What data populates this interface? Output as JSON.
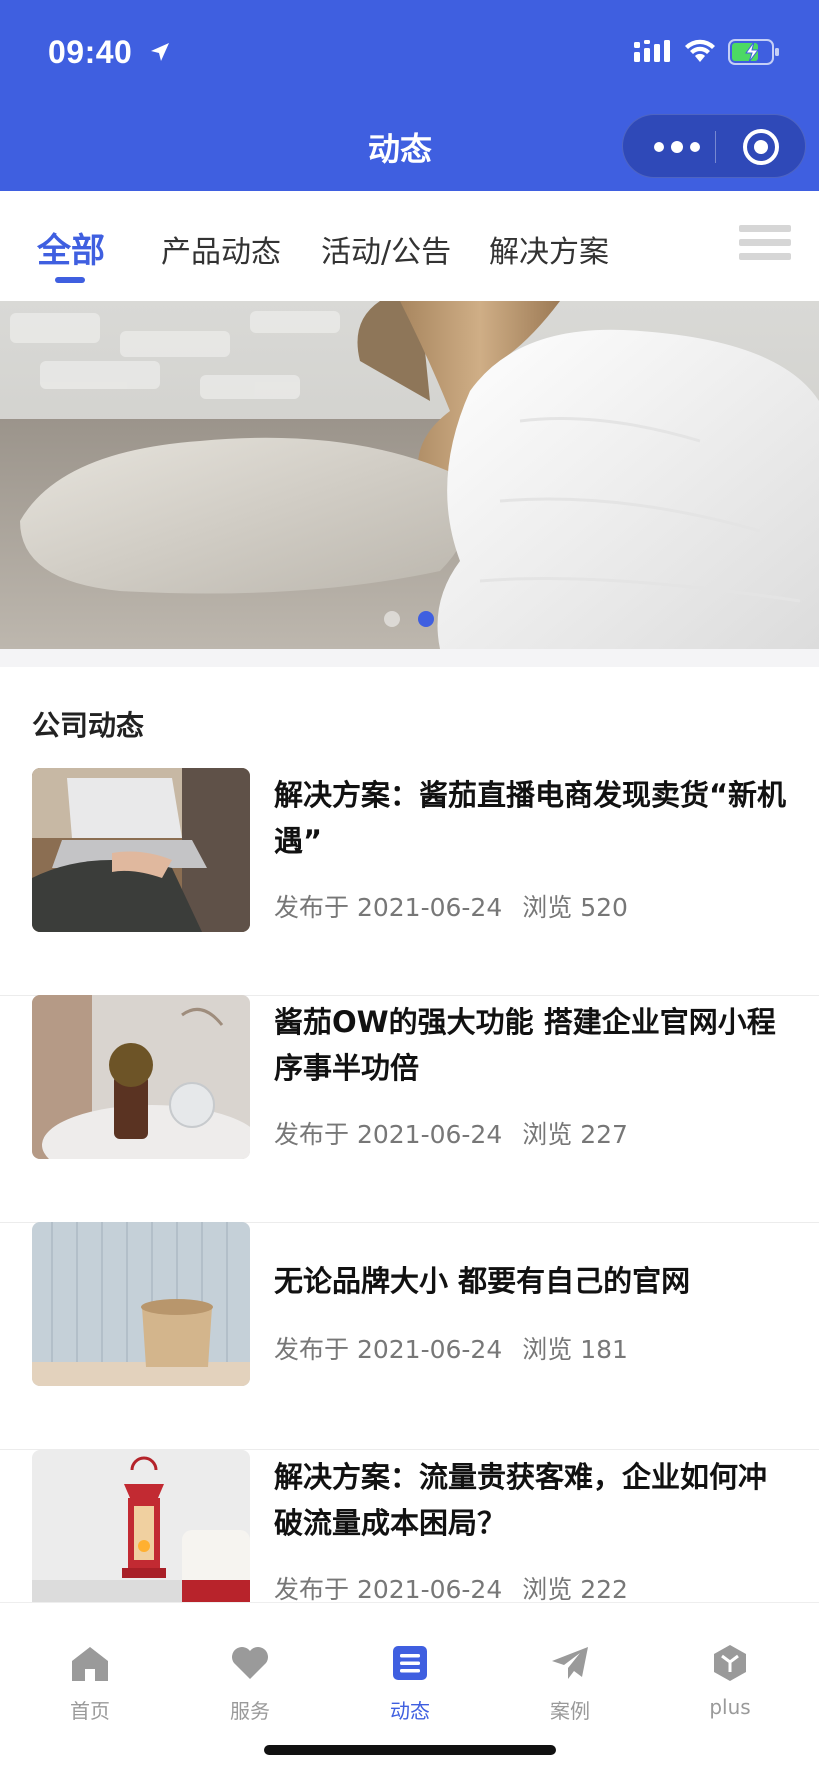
{
  "status_bar": {
    "time": "09:40"
  },
  "nav": {
    "title": "动态"
  },
  "colors": {
    "primary": "#3f5fe0",
    "text": "#222222",
    "meta": "#777777",
    "inactive": "#9a9a9a"
  },
  "tabs": [
    {
      "label": "全部",
      "active": true
    },
    {
      "label": "产品动态",
      "active": false
    },
    {
      "label": "活动/公告",
      "active": false
    },
    {
      "label": "解决方案",
      "active": false
    }
  ],
  "banner": {
    "slide_count": 2,
    "active_index": 1
  },
  "section": {
    "title": "公司动态"
  },
  "articles": [
    {
      "title": "解决方案：酱茄直播电商发现卖货“新机遇”",
      "published": "发布于 2021-06-24",
      "views": "浏览 520",
      "thumb_icon": "laptop-typing-photo"
    },
    {
      "title": "酱茄OW的强大功能 搭建企业官网小程序事半功倍",
      "published": "发布于 2021-06-24",
      "views": "浏览 227",
      "thumb_icon": "glass-bottle-photo"
    },
    {
      "title": "无论品牌大小 都要有自己的官网",
      "published": "发布于 2021-06-24",
      "views": "浏览 181",
      "thumb_icon": "wicker-basket-photo"
    },
    {
      "title": "解决方案：流量贵获客难，企业如何冲破流量成本困局？",
      "published": "发布于 2021-06-24",
      "views": "浏览 222",
      "thumb_icon": "red-lantern-photo"
    }
  ],
  "tabbar": [
    {
      "label": "首页",
      "icon": "home-icon",
      "active": false
    },
    {
      "label": "服务",
      "icon": "heart-icon",
      "active": false
    },
    {
      "label": "动态",
      "icon": "list-icon",
      "active": true
    },
    {
      "label": "案例",
      "icon": "paper-plane-icon",
      "active": false
    },
    {
      "label": "plus",
      "icon": "cube-icon",
      "active": false
    }
  ]
}
